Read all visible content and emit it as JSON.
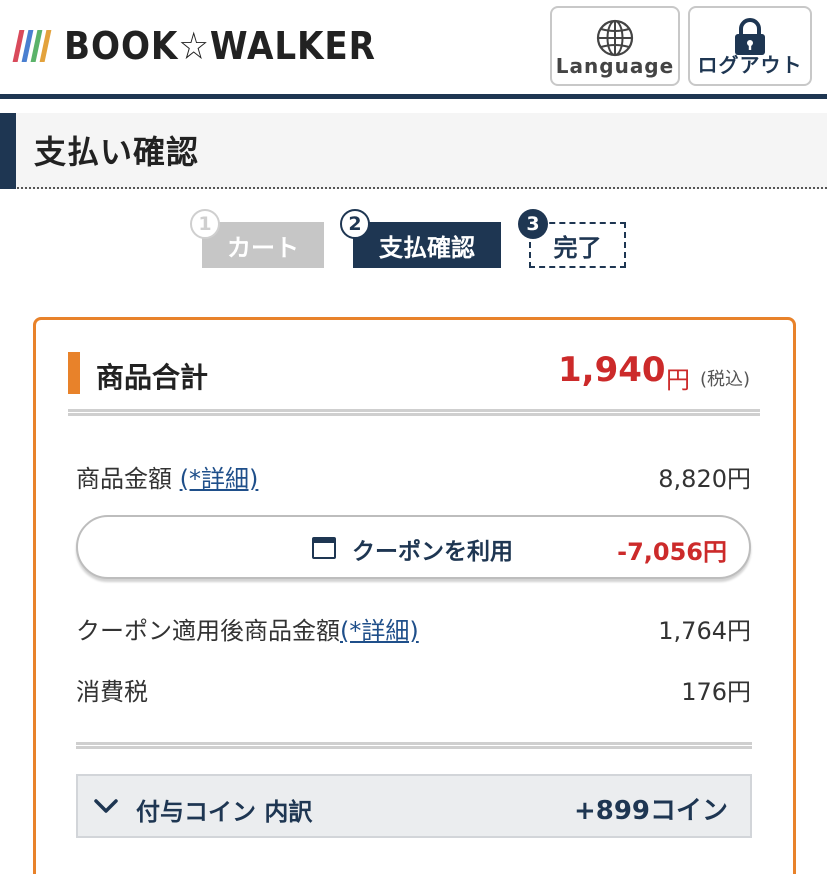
{
  "header": {
    "logo_text": "BOOK☆WALKER",
    "logo_bar_colors": [
      "#d94a5b",
      "#4a7fd0",
      "#5bb36a",
      "#e3a23c"
    ],
    "language_label": "Language",
    "logout_label": "ログアウト"
  },
  "page": {
    "title": "支払い確認"
  },
  "steps": [
    {
      "number": "1",
      "label": "カート",
      "state": "done"
    },
    {
      "number": "2",
      "label": "支払確認",
      "state": "current"
    },
    {
      "number": "3",
      "label": "完了",
      "state": "upcoming"
    }
  ],
  "summary": {
    "total_label": "商品合計",
    "total_amount": "1,940",
    "total_currency": "円",
    "total_tax_note": "(税込)",
    "subtotal_label": "商品金額",
    "subtotal_detail_link": "(*詳細)",
    "subtotal_value": "8,820円",
    "coupon_button_label": "クーポンを利用",
    "coupon_discount": "-7,056円",
    "after_coupon_label": "クーポン適用後商品金額",
    "after_coupon_detail_link": "(*詳細)",
    "after_coupon_value": "1,764円",
    "tax_label": "消費税",
    "tax_value": "176円",
    "coins_label": "付与コイン 内訳",
    "coins_value": "+899コイン"
  },
  "colors": {
    "navy": "#1e3652",
    "orange_accent": "#e8822a",
    "price_red": "#cc2a2a"
  }
}
